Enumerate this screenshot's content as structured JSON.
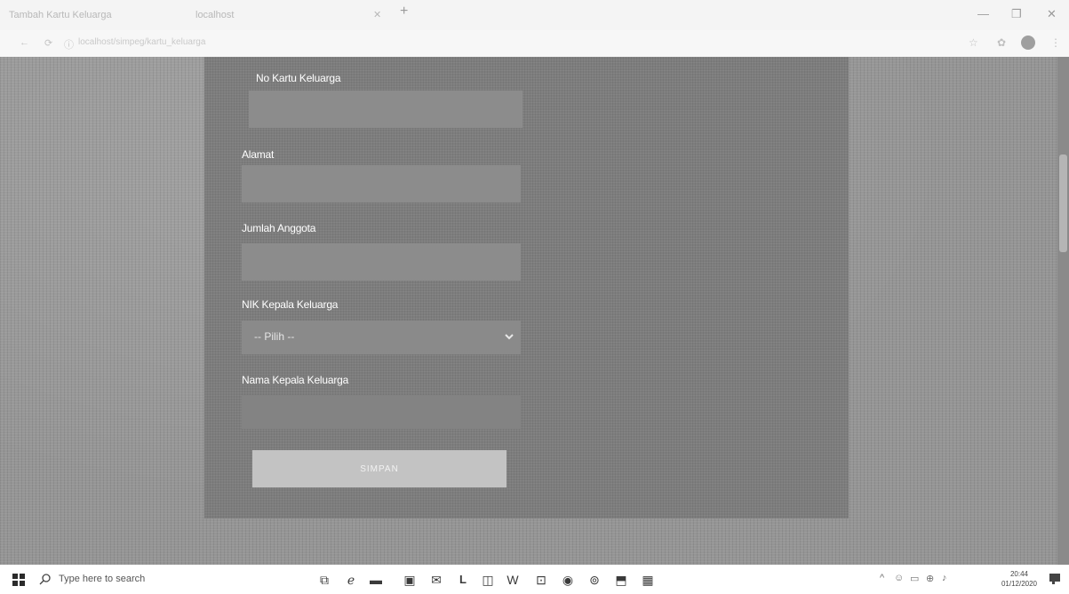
{
  "browser": {
    "tabs": [
      {
        "label": "Tambah Kartu Keluarga"
      },
      {
        "label": "localhost"
      }
    ],
    "new_tab_label": "+",
    "window_controls": {
      "minimize": "—",
      "maximize": "❐",
      "close": "✕"
    },
    "url": "localhost/simpeg/kartu_keluarga"
  },
  "form": {
    "fields": [
      {
        "label": "No Kartu Keluarga",
        "value": ""
      },
      {
        "label": "Alamat",
        "value": ""
      },
      {
        "label": "Jumlah Anggota",
        "value": ""
      },
      {
        "label": "NIK Kepala Keluarga",
        "value": "-- Pilih --"
      },
      {
        "label": "Nama Kepala Keluarga",
        "value": ""
      }
    ],
    "submit_label": "SIMPAN"
  },
  "taskbar": {
    "search_placeholder": "Type here to search",
    "apps": [
      "task-view-icon",
      "edge-icon",
      "file-explorer-icon",
      "store-icon",
      "mail-icon",
      "L",
      "app-icon",
      "word-icon",
      "app2-icon",
      "chrome-icon",
      "settings-icon",
      "app3-icon",
      "app4-icon"
    ],
    "clock": {
      "time": "20:44",
      "date": "01/12/2020"
    }
  }
}
